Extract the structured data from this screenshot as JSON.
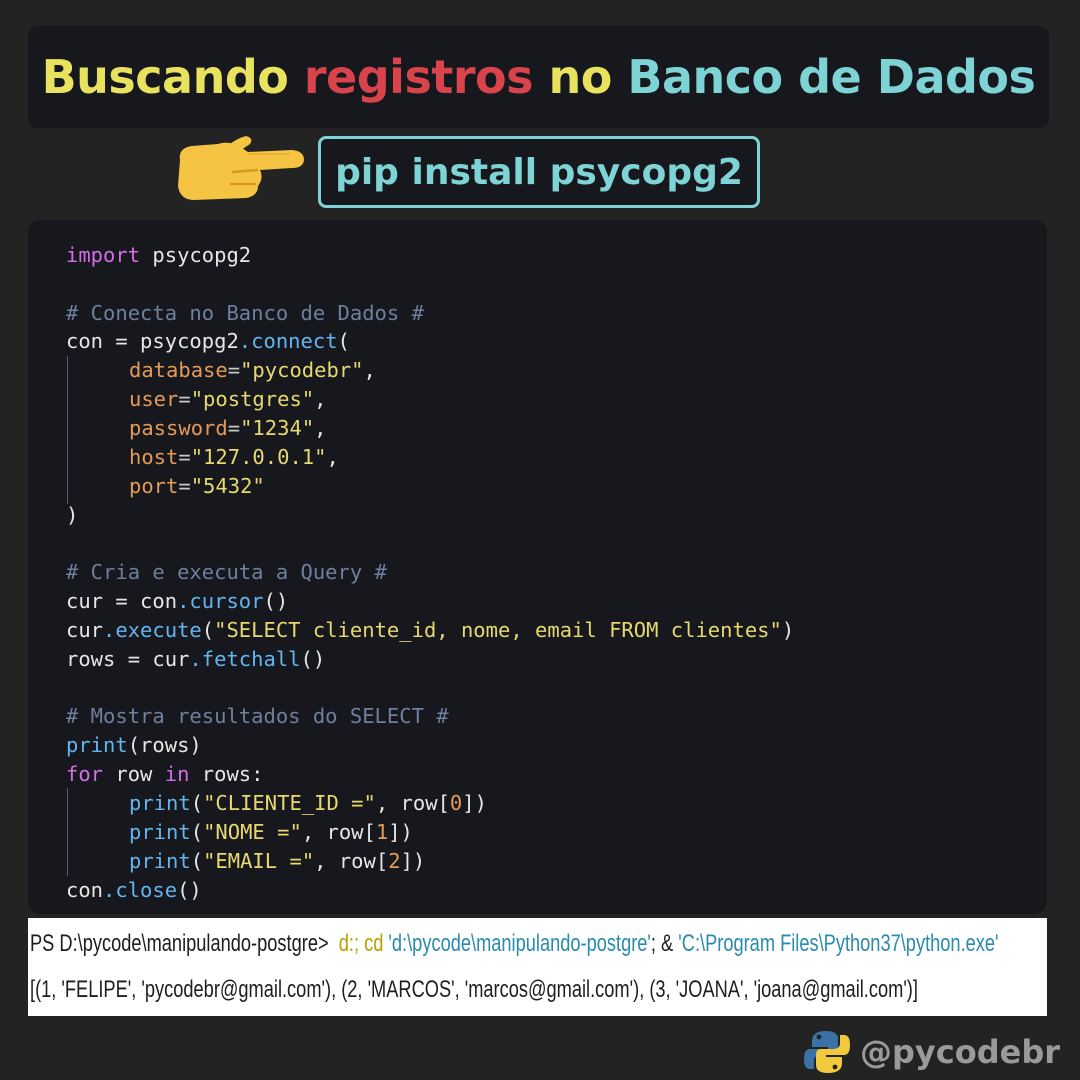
{
  "colors": {
    "background": "#232323",
    "panel": "#16181d",
    "title_yellow": "#e9e25f",
    "title_red": "#d9434b",
    "title_teal": "#7ed3d4",
    "keyword": "#d46ee6",
    "comment": "#6f7f9e",
    "function": "#63b5f0",
    "string": "#e8d86f",
    "argument": "#e59a58",
    "terminal_bg": "#ffffff"
  },
  "header": {
    "title_part1": "Buscando ",
    "title_part2": "registros",
    "title_part3": " no ",
    "title_part4": "Banco de Dados",
    "pointer_icon": "pointing-hand-icon",
    "install_command": "pip install psycopg2"
  },
  "code": {
    "l1_kw": "import",
    "l1_rest": " psycopg2",
    "l3": "# Conecta no Banco de Dados #",
    "l4_a": "con = psycopg2",
    "l4_b": ".connect",
    "l4_c": "(",
    "l5_a": "database",
    "l5_b": "=",
    "l5_c": "\"pycodebr\"",
    "l5_d": ",",
    "l6_a": "user",
    "l6_b": "=",
    "l6_c": "\"postgres\"",
    "l6_d": ",",
    "l7_a": "password",
    "l7_b": "=",
    "l7_c": "\"1234\"",
    "l7_d": ",",
    "l8_a": "host",
    "l8_b": "=",
    "l8_c": "\"127.0.0.1\"",
    "l8_d": ",",
    "l9_a": "port",
    "l9_b": "=",
    "l9_c": "\"5432\"",
    "l10": ")",
    "l12": "# Cria e executa a Query #",
    "l13_a": "cur = con",
    "l13_b": ".cursor",
    "l13_c": "()",
    "l14_a": "cur",
    "l14_b": ".execute",
    "l14_c": "(",
    "l14_d": "\"SELECT cliente_id, nome, email FROM clientes\"",
    "l14_e": ")",
    "l15_a": "rows = cur",
    "l15_b": ".fetchall",
    "l15_c": "()",
    "l17": "# Mostra resultados do SELECT #",
    "l18_a": "print",
    "l18_b": "(rows)",
    "l19_a": "for",
    "l19_b": " row ",
    "l19_c": "in",
    "l19_d": " rows:",
    "l20_a": "print",
    "l20_b": "(",
    "l20_c": "\"CLIENTE_ID =\"",
    "l20_d": ", row[",
    "l20_e": "0",
    "l20_f": "])",
    "l21_a": "print",
    "l21_b": "(",
    "l21_c": "\"NOME =\"",
    "l21_d": ", row[",
    "l21_e": "1",
    "l21_f": "])",
    "l22_a": "print",
    "l22_b": "(",
    "l22_c": "\"EMAIL =\"",
    "l22_d": ", row[",
    "l22_e": "2",
    "l22_f": "])",
    "l23_a": "con",
    "l23_b": ".close",
    "l23_c": "()"
  },
  "terminal": {
    "prompt": "PS D:\\pycode\\manipulando-postgre>",
    "cmd_a": "  d:; cd ",
    "cmd_b": "'d:\\pycode\\manipulando-postgre'",
    "cmd_c": "; & ",
    "cmd_d": "'C:\\Program Files\\Python37\\python.exe'",
    "output": "[(1, 'FELIPE', 'pycodebr@gmail.com'), (2, 'MARCOS', 'marcos@gmail.com'), (3, 'JOANA', 'joana@gmail.com')]"
  },
  "footer": {
    "logo_icon": "python-logo-icon",
    "handle": "@pycodebr"
  }
}
